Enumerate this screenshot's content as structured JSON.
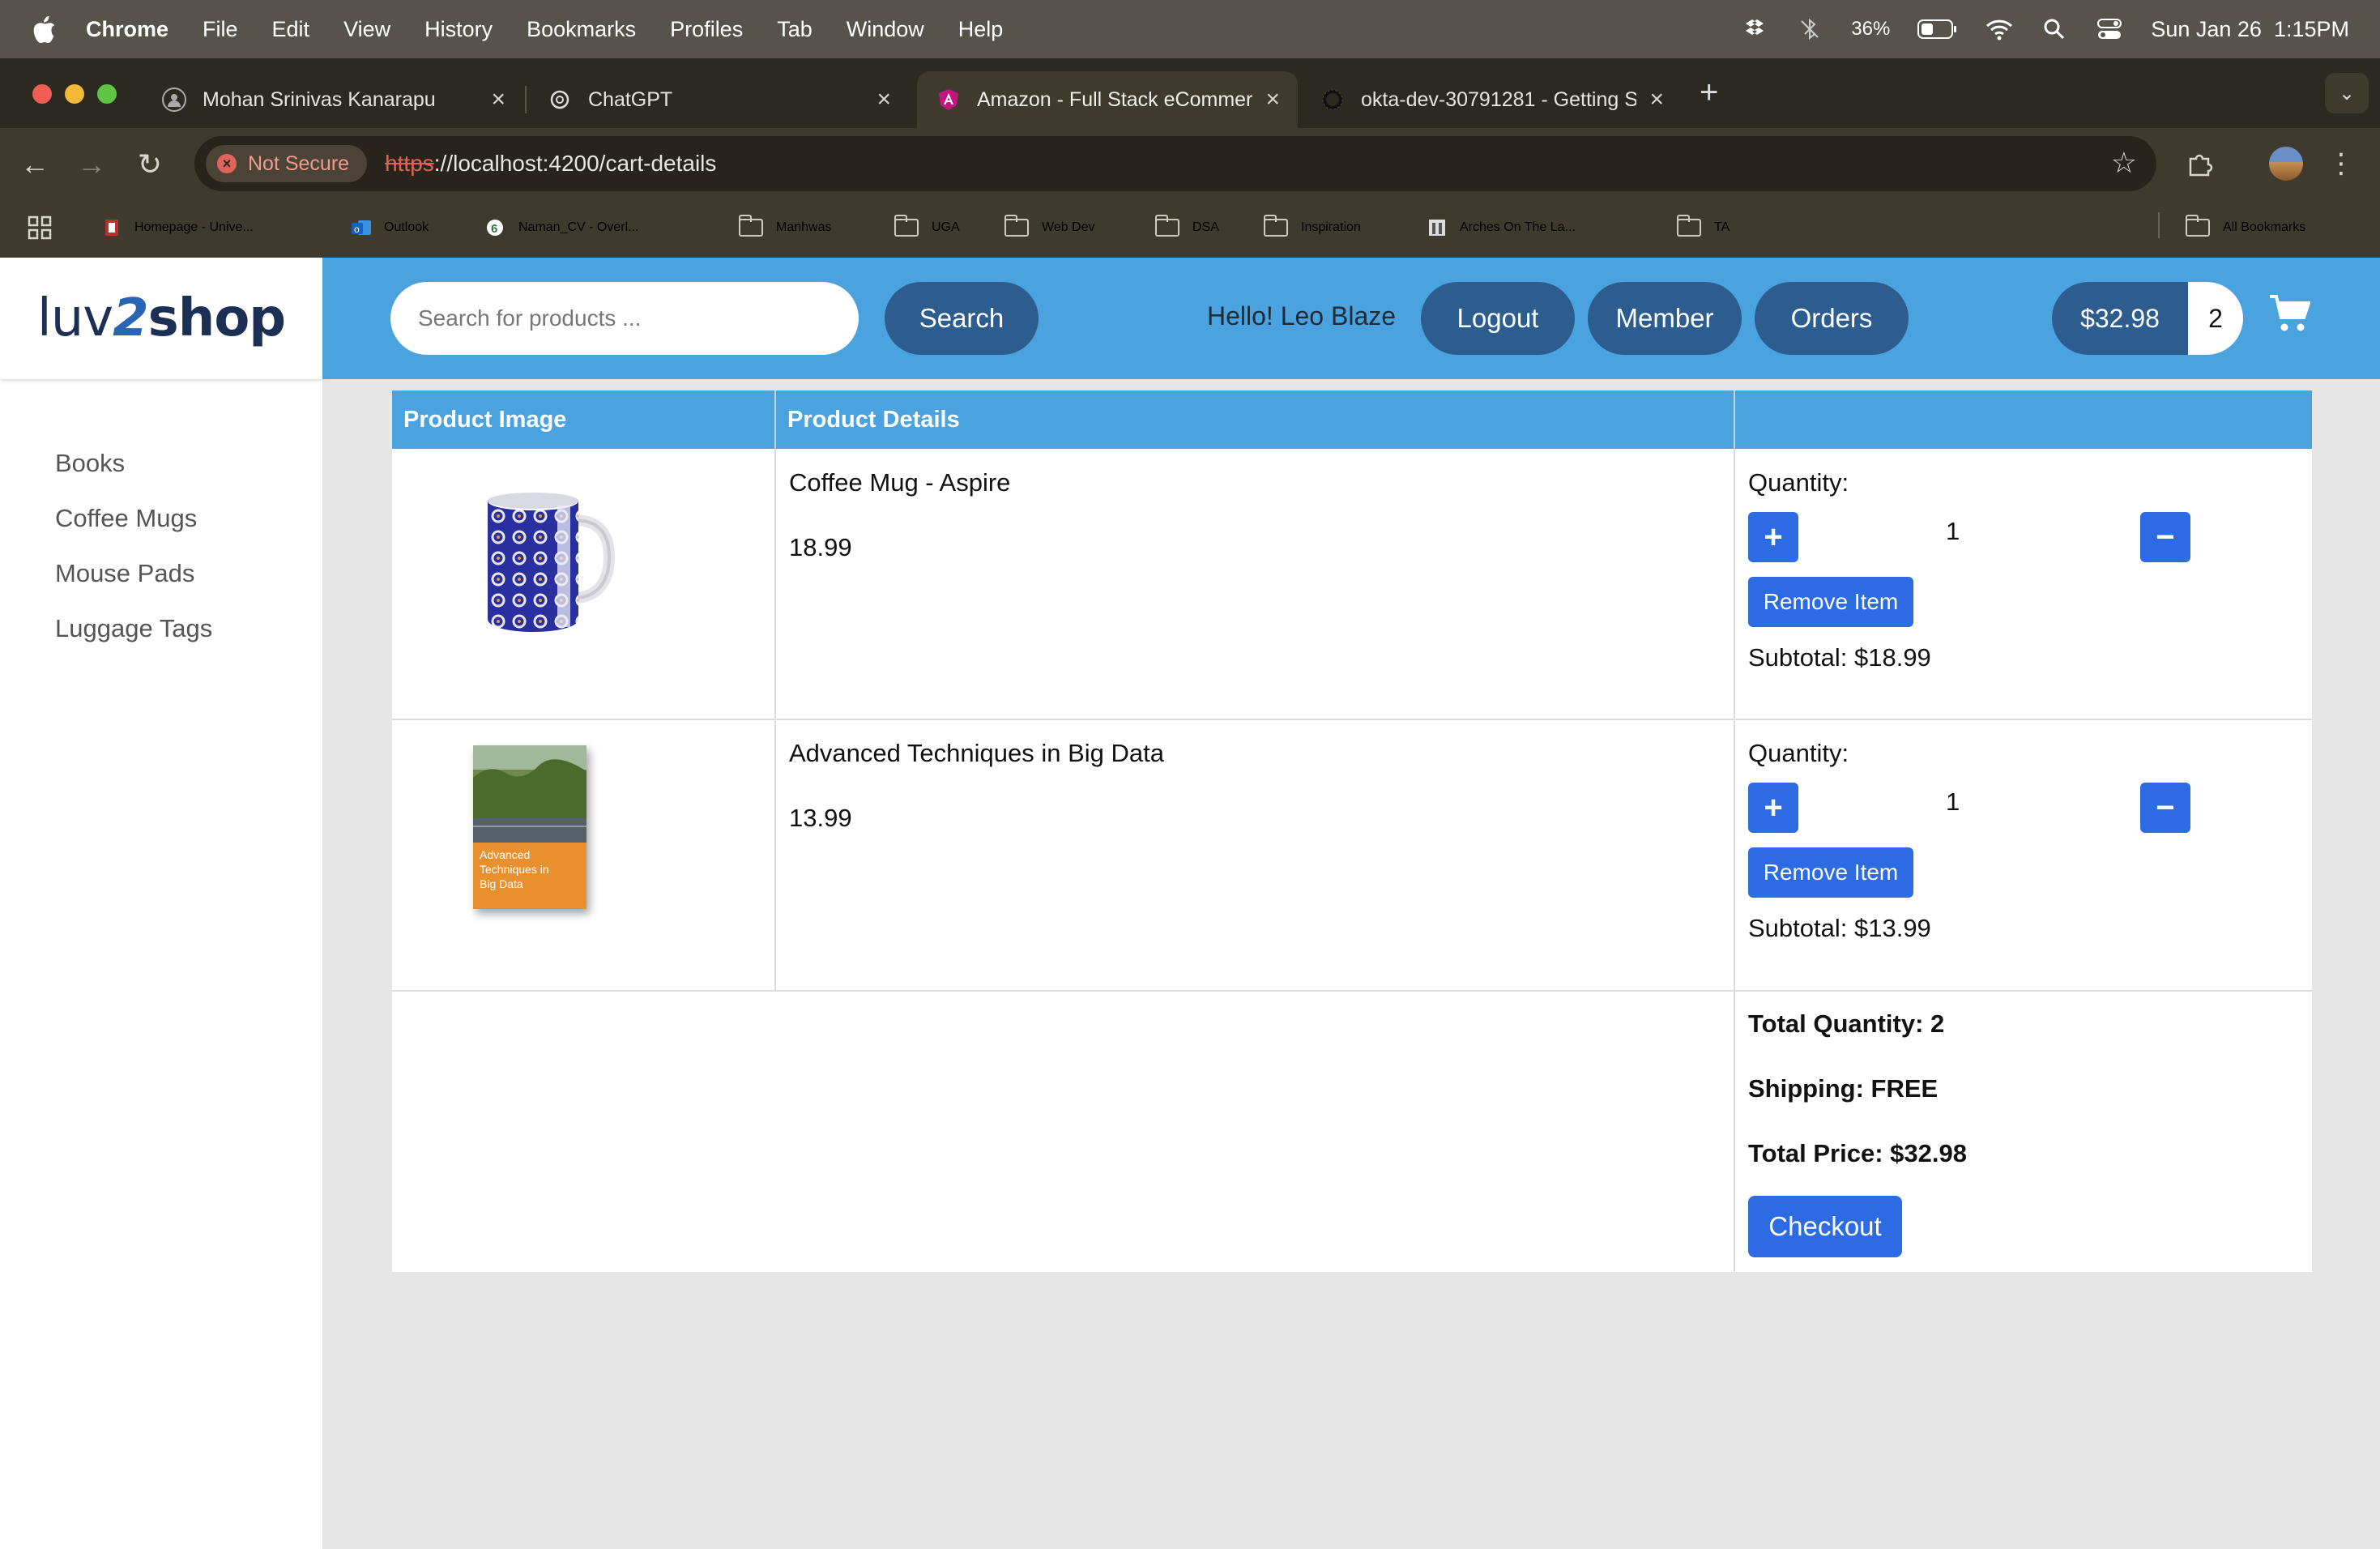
{
  "menubar": {
    "app": "Chrome",
    "items": [
      "File",
      "Edit",
      "View",
      "History",
      "Bookmarks",
      "Profiles",
      "Tab",
      "Window",
      "Help"
    ],
    "battery": "36%",
    "datetime": "Sun Jan 26  1:15PM"
  },
  "tabs": [
    {
      "title": "Mohan Srinivas Kanarapu",
      "icon": "user-icon"
    },
    {
      "title": "ChatGPT",
      "icon": "chatgpt-icon"
    },
    {
      "title": "Amazon - Full Stack eCommerce",
      "icon": "angular-icon",
      "active": true
    },
    {
      "title": "okta-dev-30791281 - Getting Started",
      "icon": "okta-icon"
    }
  ],
  "toolbar": {
    "security_label": "Not Secure",
    "url_protocol": "https",
    "url_rest": "://localhost:4200/cart-details"
  },
  "bookmarks": {
    "items": [
      "Homepage - Unive...",
      "Outlook",
      "Naman_CV - Overl...",
      "Manhwas",
      "UGA",
      "Web Dev",
      "DSA",
      "Inspiration",
      "Arches On The La...",
      "TA"
    ],
    "all_label": "All Bookmarks"
  },
  "site": {
    "logo_part1": "luv",
    "logo_part2": "2",
    "logo_part3": "shop",
    "categories": [
      "Books",
      "Coffee Mugs",
      "Mouse Pads",
      "Luggage Tags"
    ],
    "search_placeholder": "Search for products ...",
    "search_button": "Search",
    "greeting": "Hello! Leo Blaze",
    "logout_button": "Logout",
    "member_button": "Member",
    "orders_button": "Orders",
    "cart_total": "$32.98",
    "cart_quantity": "2"
  },
  "cart": {
    "headers": [
      "Product Image",
      "Product Details",
      ""
    ],
    "items": [
      {
        "name": "Coffee Mug - Aspire",
        "price": "18.99",
        "quantity_label": "Quantity:",
        "quantity": "1",
        "remove_label": "Remove Item",
        "subtotal": "Subtotal: $18.99"
      },
      {
        "name": "Advanced Techniques in Big Data",
        "price": "13.99",
        "quantity_label": "Quantity:",
        "quantity": "1",
        "remove_label": "Remove Item",
        "subtotal": "Subtotal: $13.99"
      }
    ],
    "book_cover_text": [
      "Advanced",
      "Techniques in",
      "Big Data"
    ],
    "summary": {
      "total_quantity": "Total Quantity: 2",
      "shipping": "Shipping: FREE",
      "total_price": "Total Price: $32.98",
      "checkout_label": "Checkout"
    }
  },
  "colors": {
    "header_blue": "#4aa3df",
    "pill_navy": "#2d5c8f",
    "action_blue": "#2d6be4"
  }
}
